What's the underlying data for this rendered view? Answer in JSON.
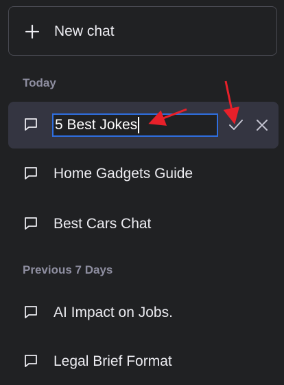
{
  "new_chat": {
    "label": "New chat",
    "icon": "plus-icon"
  },
  "sections": [
    {
      "title": "Today",
      "items": [
        {
          "title": "5 Best Jokes",
          "editing": true,
          "icon": "chat-bubble-icon"
        },
        {
          "title": "Home Gadgets Guide",
          "icon": "chat-bubble-icon"
        },
        {
          "title": "Best Cars Chat",
          "icon": "chat-bubble-icon"
        }
      ]
    },
    {
      "title": "Previous 7 Days",
      "items": [
        {
          "title": "AI Impact on Jobs.",
          "icon": "chat-bubble-icon"
        },
        {
          "title": "Legal Brief Format",
          "icon": "chat-bubble-icon"
        }
      ]
    }
  ],
  "edit_actions": {
    "confirm_icon": "check-icon",
    "cancel_icon": "close-icon"
  },
  "colors": {
    "background": "#202123",
    "active_row": "#343541",
    "input_border": "#2f6fe0",
    "annotation_arrow": "#e8202a",
    "section_title": "#8e8ea0"
  }
}
